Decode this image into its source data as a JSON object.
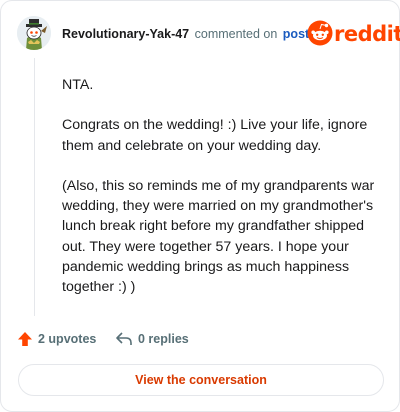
{
  "header": {
    "username": "Revolutionary-Yak-47",
    "action_text": "commented on",
    "post_link": "post",
    "brand_name": "reddit"
  },
  "comment": {
    "paragraphs": [
      "NTA.",
      "Congrats on the wedding! :) Live your life, ignore them and celebrate on your wedding day.",
      "(Also, this so reminds me of my grandparents war wedding, they were married on my grandmother's lunch break right before my grandfather shipped out. They were together 57 years. I hope your pandemic wedding brings as much happiness together :) )"
    ]
  },
  "actions": {
    "upvotes": "2 upvotes",
    "replies": "0 replies"
  },
  "cta": {
    "label": "View the conversation"
  },
  "colors": {
    "brand": "#ff4500",
    "cta_text": "#d93a00",
    "link": "#1a5bbf",
    "muted": "#576f76"
  }
}
